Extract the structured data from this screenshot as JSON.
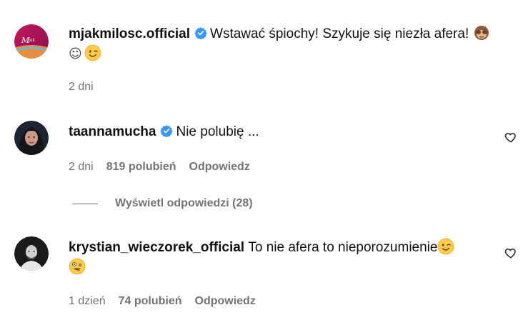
{
  "comments": [
    {
      "username": "mjakmilosc.official",
      "verified": true,
      "text": "Wstawać śpiochy! Szykuje się niezła afera!",
      "text_line2_glyph": "☺",
      "emojis": [
        "see-no-evil-monkey",
        "winking-face"
      ],
      "time": "2 dni",
      "likes": "",
      "reply_label": ""
    },
    {
      "username": "taannamucha",
      "verified": true,
      "text": "Nie polubię ...",
      "time": "2 dni",
      "likes": "819 polubień",
      "reply_label": "Odpowiedz"
    },
    {
      "username": "krystian_wieczorek_official",
      "verified": false,
      "text": "To nie afera to nieporozumienie",
      "emojis": [
        "winking-face",
        "zany-face"
      ],
      "time": "1 dzień",
      "likes": "74 polubień",
      "reply_label": "Odpowiedz"
    }
  ],
  "view_replies_label": "Wyświetl odpowiedzi (28)",
  "colors": {
    "verified_blue": "#3897f0",
    "meta_gray": "#737373",
    "emoji_yellow": "#ffcc4d"
  }
}
